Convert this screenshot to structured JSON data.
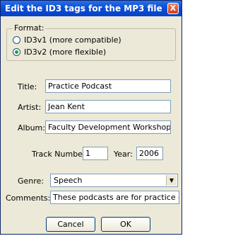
{
  "dialog": {
    "title": "Edit the ID3 tags for the MP3 file",
    "close_glyph": "X"
  },
  "format": {
    "label": "Format:",
    "options": [
      {
        "label": "ID3v1 (more compatible)",
        "selected": false
      },
      {
        "label": "ID3v2 (more flexible)",
        "selected": true
      }
    ]
  },
  "fields": {
    "title": {
      "label": "Title:",
      "value": "Practice Podcast"
    },
    "artist": {
      "label": "Artist:",
      "value": "Jean Kent"
    },
    "album": {
      "label": "Album:",
      "value": "Faculty Development Workshops"
    },
    "track": {
      "label": "Track Number:",
      "value": "1"
    },
    "year": {
      "label": "Year:",
      "value": "2006"
    },
    "genre": {
      "label": "Genre:",
      "value": "Speech"
    },
    "comments": {
      "label": "Comments:",
      "value": "These podcasts are for practice only."
    }
  },
  "buttons": {
    "cancel": "Cancel",
    "ok": "OK"
  },
  "icons": {
    "close": "close-icon",
    "dropdown": "chevron-down-icon"
  }
}
